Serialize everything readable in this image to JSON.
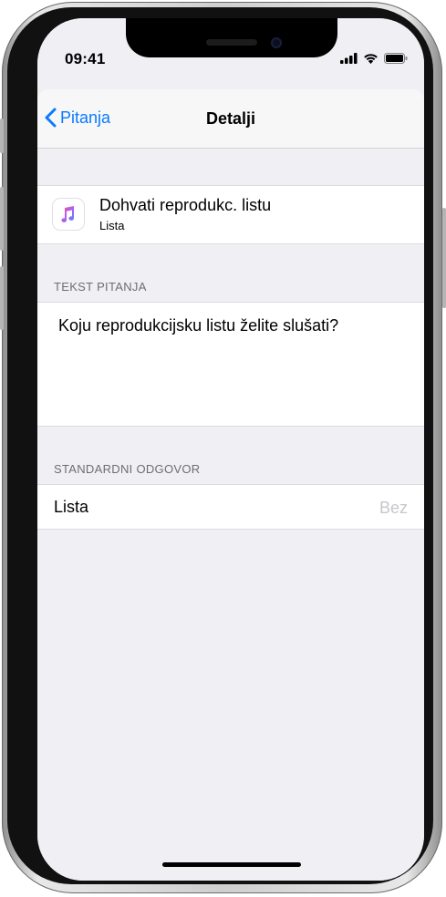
{
  "status": {
    "time": "09:41"
  },
  "nav": {
    "back_label": "Pitanja",
    "title": "Detalji"
  },
  "action": {
    "title": "Dohvati reprodukc. listu",
    "subtitle": "Lista",
    "icon": "music-note-icon"
  },
  "question": {
    "header": "TEKST PITANJA",
    "text": "Koju reprodukcijsku listu želite slušati?"
  },
  "default_answer": {
    "header": "STANDARDNI ODGOVOR",
    "label": "Lista",
    "value_placeholder": "Bez"
  },
  "colors": {
    "accent": "#0a7aff",
    "background": "#efeff4",
    "secondary_text": "#6d6d72",
    "placeholder": "#c7c7cc"
  }
}
